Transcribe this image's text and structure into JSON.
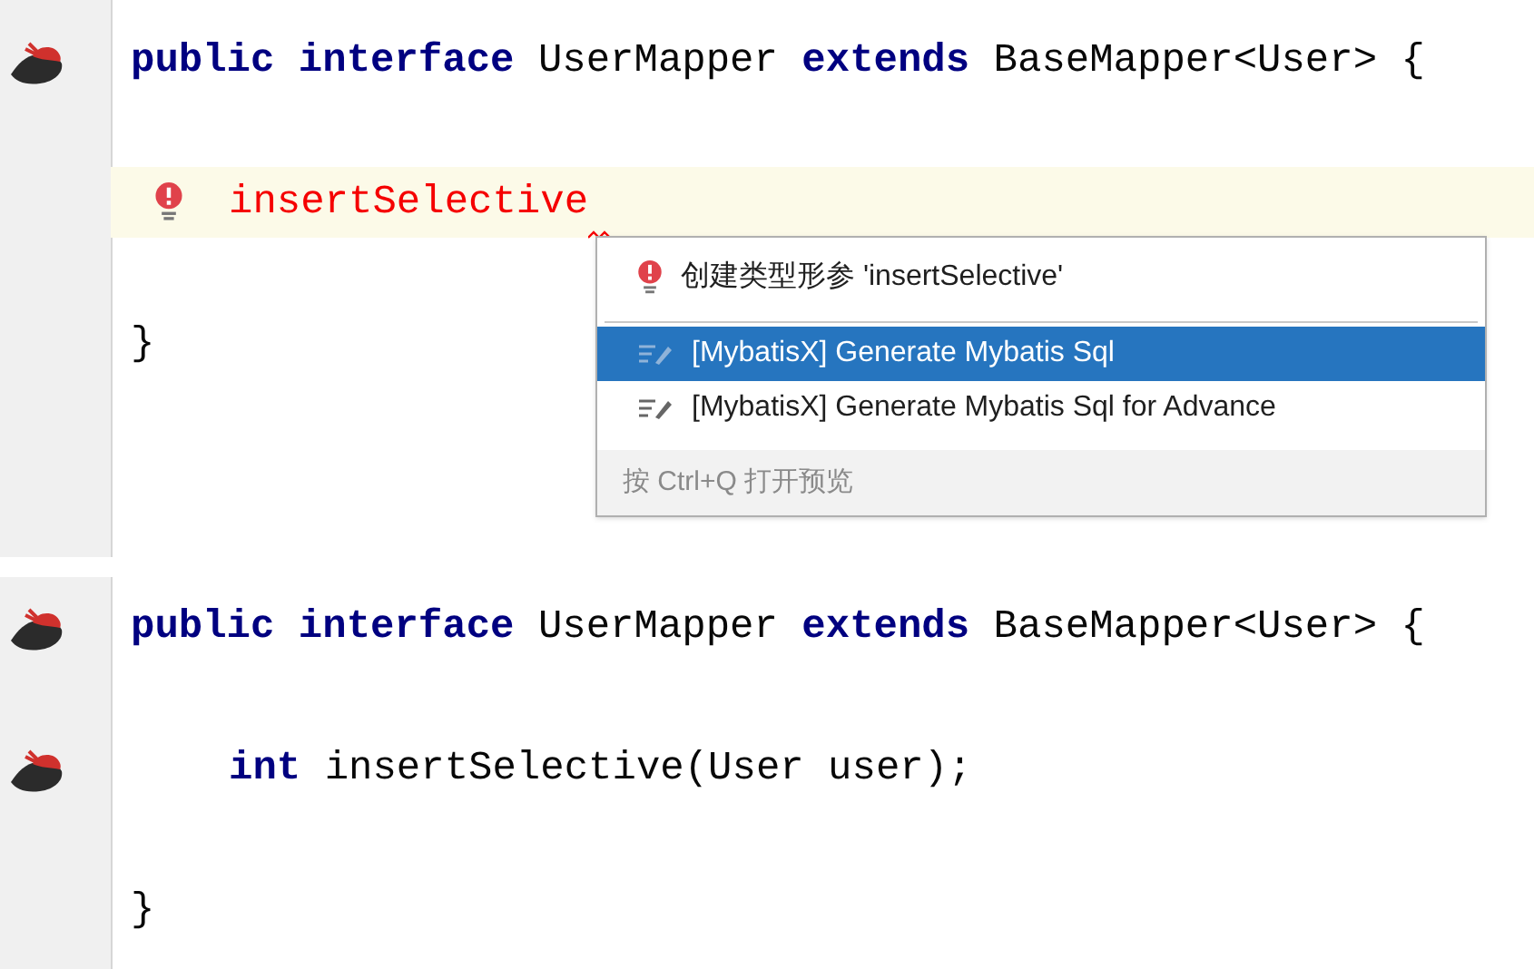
{
  "editors": [
    {
      "lines": [
        {
          "kind": "code",
          "gutter_icon": true,
          "highlighted": false,
          "indented": false,
          "bulb": false,
          "tokens": [
            {
              "text": "public interface ",
              "kind": "keyword"
            },
            {
              "text": "UserMapper ",
              "kind": "plain"
            },
            {
              "text": "extends ",
              "kind": "keyword"
            },
            {
              "text": "BaseMapper<User> {",
              "kind": "plain"
            }
          ]
        },
        {
          "kind": "blank"
        },
        {
          "kind": "code",
          "gutter_icon": false,
          "highlighted": true,
          "indented": true,
          "bulb": true,
          "squiggle": true,
          "tokens": [
            {
              "text": "insertSelective",
              "kind": "error"
            }
          ]
        },
        {
          "kind": "blank"
        },
        {
          "kind": "code",
          "gutter_icon": false,
          "highlighted": false,
          "indented": false,
          "bulb": false,
          "tokens": [
            {
              "text": "}",
              "kind": "plain"
            }
          ]
        }
      ],
      "popup": {
        "items": [
          {
            "kind": "error",
            "label": "创建类型形参 'insertSelective'",
            "selected": false
          },
          {
            "kind": "separator"
          },
          {
            "kind": "action",
            "label": "[MybatisX] Generate Mybatis Sql",
            "selected": true
          },
          {
            "kind": "action",
            "label": "[MybatisX] Generate Mybatis Sql for Advance",
            "selected": false
          }
        ],
        "hint": "按 Ctrl+Q 打开预览"
      }
    },
    {
      "lines": [
        {
          "kind": "code",
          "gutter_icon": true,
          "highlighted": false,
          "indented": false,
          "bulb": false,
          "tokens": [
            {
              "text": "public interface ",
              "kind": "keyword"
            },
            {
              "text": "UserMapper ",
              "kind": "plain"
            },
            {
              "text": "extends ",
              "kind": "keyword"
            },
            {
              "text": "BaseMapper<User> {",
              "kind": "plain"
            }
          ]
        },
        {
          "kind": "blank"
        },
        {
          "kind": "code",
          "gutter_icon": true,
          "highlighted": false,
          "indented": true,
          "bulb": false,
          "tokens": [
            {
              "text": "int ",
              "kind": "keyword"
            },
            {
              "text": "insertSelective(User user);",
              "kind": "plain"
            }
          ]
        },
        {
          "kind": "blank"
        },
        {
          "kind": "code",
          "gutter_icon": false,
          "highlighted": false,
          "indented": false,
          "bulb": false,
          "tokens": [
            {
              "text": "}",
              "kind": "plain"
            }
          ]
        }
      ]
    }
  ]
}
